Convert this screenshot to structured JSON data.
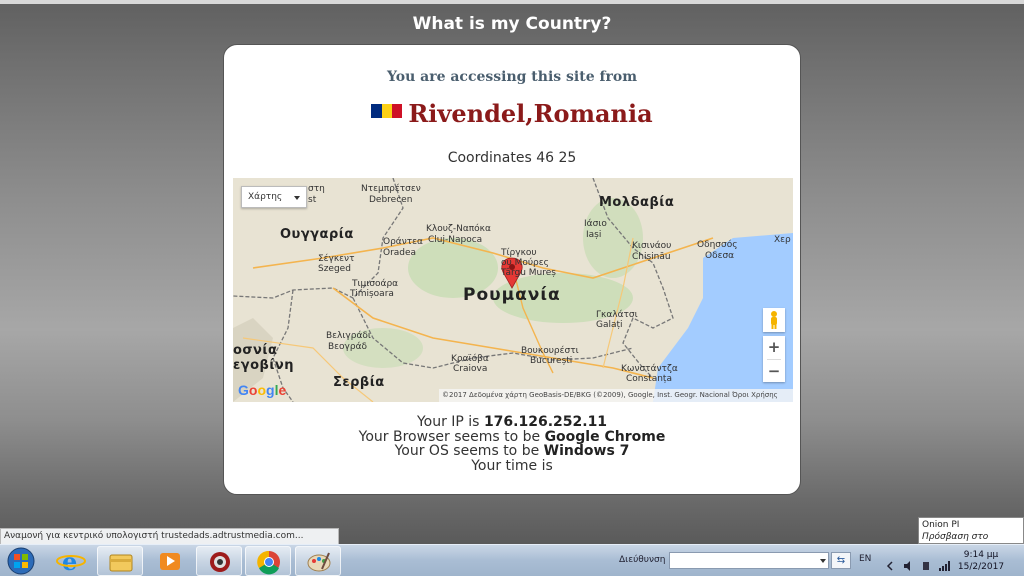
{
  "site": {
    "title": "What is my Country?",
    "access_line": "You are accessing this site from",
    "location": "Rivendel,Romania",
    "coordinates": "Coordinates 46 25"
  },
  "map": {
    "type_selector": "Χάρτης",
    "labels": {
      "hungary": "Ουγγαρία",
      "romania": "Ρουμανία",
      "moldova": "Μολδαβία",
      "serbia": "Σερβία",
      "bosnia_a": "οσνία",
      "bosnia_b": "εγοβίνη",
      "debrecen_gr": "Ντεμπρέτσεν",
      "debrecen": "Debrecen",
      "cluj_gr": "Κλουζ-Ναπόκα",
      "cluj": "Cluj-Napoca",
      "iasi_gr": "Ιάσιο",
      "iasi": "Iași",
      "oradea_gr": "Οράντεα",
      "oradea": "Oradea",
      "szeged_gr": "Σέγκεντ",
      "szeged": "Szeged",
      "timisoara_gr": "Τιμισοάρα",
      "timisoara": "Timișoara",
      "targu_gr": "Τίργκου\nΜούρες",
      "targu": "Târgu Mureș",
      "chisinau_gr": "Κισινάου",
      "chisinau": "Chișinău",
      "odessa_gr": "Οδησσός",
      "odessa": "Οδεσα",
      "kherson": "Χερ",
      "galati_gr": "Γκαλάτσι",
      "galati": "Galați",
      "belgrade_gr": "Βελιγράδι",
      "belgrade": "Βεογράδ",
      "craiova_gr": "Κραϊόβα",
      "craiova": "Craiova",
      "bucharest_gr": "Βουκουρέστι",
      "bucharest": "București",
      "constanta_gr": "Κωνστάντζα",
      "constanta": "Constanța",
      "top_left_a": "στη",
      "top_left_b": "st"
    },
    "google_logo": "Google",
    "attribution": "©2017 Δεδομένα χάρτη GeoBasis-DE/BKG (©2009), Google, Inst. Geogr. Nacional    Όροι Χρήσης",
    "zoom_in": "+",
    "zoom_out": "−"
  },
  "info": {
    "ip_prefix": "Your IP is",
    "ip": "176.126.252.11",
    "browser_prefix": "Your Browser seems to be",
    "browser": "Google Chrome",
    "os_prefix": "Your OS seems to be",
    "os": "Windows 7",
    "time_prefix": "Your time is"
  },
  "status_bar": "Αναμονή για κεντρικό υπολογιστή trustedads.adtrustmedia.com...",
  "tooltip": {
    "line1": "Onion PI",
    "line2": "Πρόσβαση στο Internet"
  },
  "taskbar": {
    "address_label": "Διεύθυνση",
    "language": "EN",
    "time": "9:14 μμ",
    "date": "15/2/2017"
  },
  "colors": {
    "location_text": "#8b1a1a",
    "access_line": "#4a5e6e",
    "flag_blue": "#002b7f",
    "flag_yellow": "#fcd116",
    "flag_red": "#ce1126",
    "map_pin": "#e53935",
    "sea": "#a3ccff"
  }
}
